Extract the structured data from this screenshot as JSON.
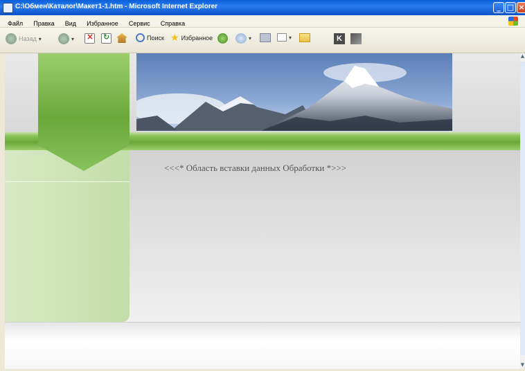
{
  "window": {
    "title": "C:\\Обмен\\Каталог\\Макет1-1.htm - Microsoft Internet Explorer",
    "minimize_glyph": "_",
    "maximize_glyph": "□",
    "close_glyph": "×"
  },
  "menu": {
    "items": [
      "Файл",
      "Правка",
      "Вид",
      "Избранное",
      "Сервис",
      "Справка"
    ]
  },
  "toolbar": {
    "back_label": "Назад",
    "search_label": "Поиск",
    "favorites_label": "Избранное",
    "dropdown_glyph": "▾",
    "k_label": "K"
  },
  "content": {
    "insert_placeholder": "<<<* Область вставки данных Обработки *>>>"
  },
  "scrollbar": {
    "up_glyph": "▲",
    "down_glyph": "▼"
  },
  "colors": {
    "title_bar": "#0a5fd8",
    "accent_green": "#6aa838",
    "sidebar_green": "#c3dea8"
  }
}
